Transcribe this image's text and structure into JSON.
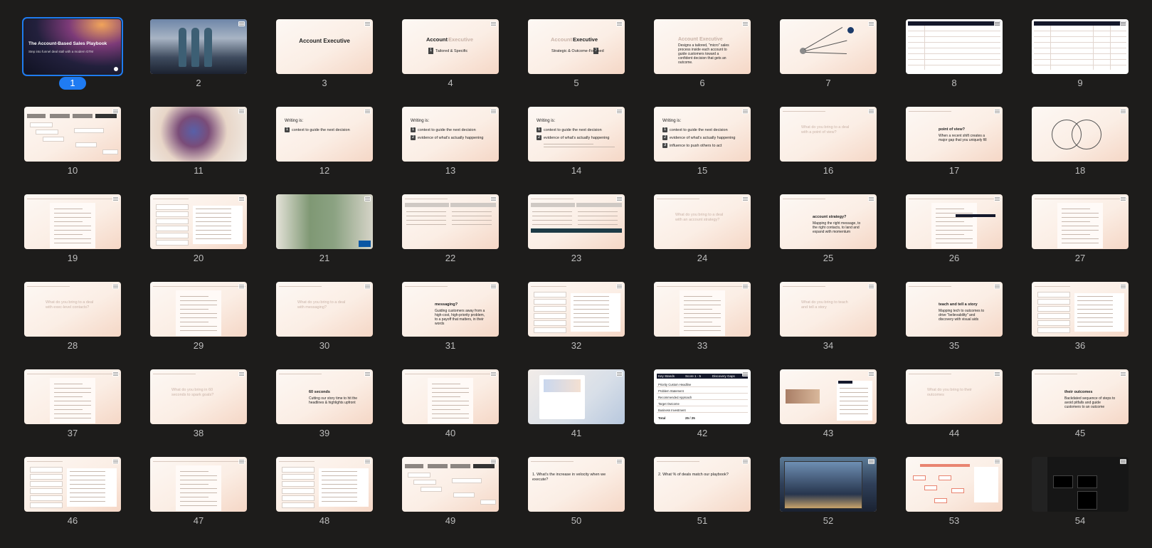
{
  "selected": 1,
  "slides": [
    {
      "n": "1",
      "kind": "title",
      "title": "The Account-Based Sales Playbook",
      "subtitle": "Step into funnel deal stall with a modern GTM"
    },
    {
      "n": "2",
      "kind": "photo",
      "scene": "people"
    },
    {
      "n": "3",
      "kind": "heading",
      "text": "Account Executive"
    },
    {
      "n": "4",
      "kind": "split",
      "a": "Account",
      "b": "Executive",
      "tag": "1",
      "sub": "Tailored & Specific"
    },
    {
      "n": "5",
      "kind": "split2",
      "a": "Account",
      "b": "Executive",
      "tag": "2",
      "sub": "Strategic & Outcome-Focused"
    },
    {
      "n": "6",
      "kind": "def",
      "head": "Account Executive",
      "body": "Designs a tailored, \"micro\" sales process inside each account to guide customers toward a confident decision that gets an outcome."
    },
    {
      "n": "7",
      "kind": "arrows"
    },
    {
      "n": "8",
      "kind": "table"
    },
    {
      "n": "9",
      "kind": "table2"
    },
    {
      "n": "10",
      "kind": "flow"
    },
    {
      "n": "11",
      "kind": "photo",
      "scene": "dolls"
    },
    {
      "n": "12",
      "kind": "writing",
      "lead": "Writing is:",
      "items": [
        "context to guide the next decision"
      ],
      "count": 1
    },
    {
      "n": "13",
      "kind": "writing",
      "lead": "Writing is:",
      "items": [
        "context to guide the next decision",
        "evidence of what's actually happening"
      ],
      "count": 2
    },
    {
      "n": "14",
      "kind": "writing",
      "lead": "Writing is:",
      "items": [
        "context to guide the next decision",
        "evidence of what's actually happening"
      ],
      "count": 2
    },
    {
      "n": "15",
      "kind": "writing",
      "lead": "Writing is:",
      "items": [
        "context to guide the next decision",
        "evidence of what's actually happening",
        "influence to push others to act"
      ],
      "count": 3
    },
    {
      "n": "16",
      "kind": "question",
      "q": "What do you bring to a deal with a point of view?"
    },
    {
      "n": "17",
      "kind": "answer",
      "q": "point of view?",
      "a": "When a recent shift creates a major gap that you uniquely fill"
    },
    {
      "n": "18",
      "kind": "venn"
    },
    {
      "n": "19",
      "kind": "doc"
    },
    {
      "n": "20",
      "kind": "boxes"
    },
    {
      "n": "21",
      "kind": "photo",
      "scene": "kitchen"
    },
    {
      "n": "22",
      "kind": "compare"
    },
    {
      "n": "23",
      "kind": "compare2"
    },
    {
      "n": "24",
      "kind": "question",
      "q": "What do you bring to a deal with an account strategy?"
    },
    {
      "n": "25",
      "kind": "answer",
      "q": "account strategy?",
      "a": "Mapping the right message, to the right contacts, to land and expand with momentum"
    },
    {
      "n": "26",
      "kind": "doc2"
    },
    {
      "n": "27",
      "kind": "doc"
    },
    {
      "n": "28",
      "kind": "question",
      "q": "What do you bring to a deal with exec-level contacts?"
    },
    {
      "n": "29",
      "kind": "doc"
    },
    {
      "n": "30",
      "kind": "question",
      "q": "What do you bring to a deal with messaging?"
    },
    {
      "n": "31",
      "kind": "answer",
      "q": "messaging?",
      "a": "Guiding customers away from a high-cost, high-priority problem, to a payoff that matters, in their words"
    },
    {
      "n": "32",
      "kind": "boxes"
    },
    {
      "n": "33",
      "kind": "doc"
    },
    {
      "n": "34",
      "kind": "question",
      "q": "What do you bring to teach and tell a story"
    },
    {
      "n": "35",
      "kind": "answer",
      "q": "teach and tell a story",
      "a": "Mapping tech to outcomes to drive \"believability\" and discovery with visual aids"
    },
    {
      "n": "36",
      "kind": "boxes"
    },
    {
      "n": "37",
      "kind": "doc"
    },
    {
      "n": "38",
      "kind": "question",
      "q": "What do you bring in 60 seconds to spark goals?"
    },
    {
      "n": "39",
      "kind": "answer",
      "q": "60 seconds",
      "a": "Cutting our story time to hit the headlines & highlights upfront"
    },
    {
      "n": "40",
      "kind": "doc"
    },
    {
      "n": "41",
      "kind": "screen"
    },
    {
      "n": "42",
      "kind": "score",
      "header": [
        "Key Stands",
        "Score 1 - 5",
        "Discovery Gaps"
      ],
      "rows": [
        "Priority Custom Headline",
        "Problem Statement",
        "Recommended Approach",
        "Target Outcome",
        "Business Investment"
      ],
      "total": "Total",
      "totalScore": "25 / 25"
    },
    {
      "n": "43",
      "kind": "article"
    },
    {
      "n": "44",
      "kind": "question",
      "q": "What do you bring to their outcomes"
    },
    {
      "n": "45",
      "kind": "answer",
      "q": "their outcomes",
      "a": "Backdated sequence of steps to avoid pitfalls and guide customers to an outcome"
    },
    {
      "n": "46",
      "kind": "boxes"
    },
    {
      "n": "47",
      "kind": "doc"
    },
    {
      "n": "48",
      "kind": "boxes"
    },
    {
      "n": "49",
      "kind": "flow"
    },
    {
      "n": "50",
      "kind": "plain",
      "text": "1. What's the increase in velocity when we execute?"
    },
    {
      "n": "51",
      "kind": "plain2",
      "text": "2. What % of deals match our playbook?"
    },
    {
      "n": "52",
      "kind": "photo",
      "scene": "crew"
    },
    {
      "n": "53",
      "kind": "mindmap"
    },
    {
      "n": "54",
      "kind": "app"
    }
  ]
}
